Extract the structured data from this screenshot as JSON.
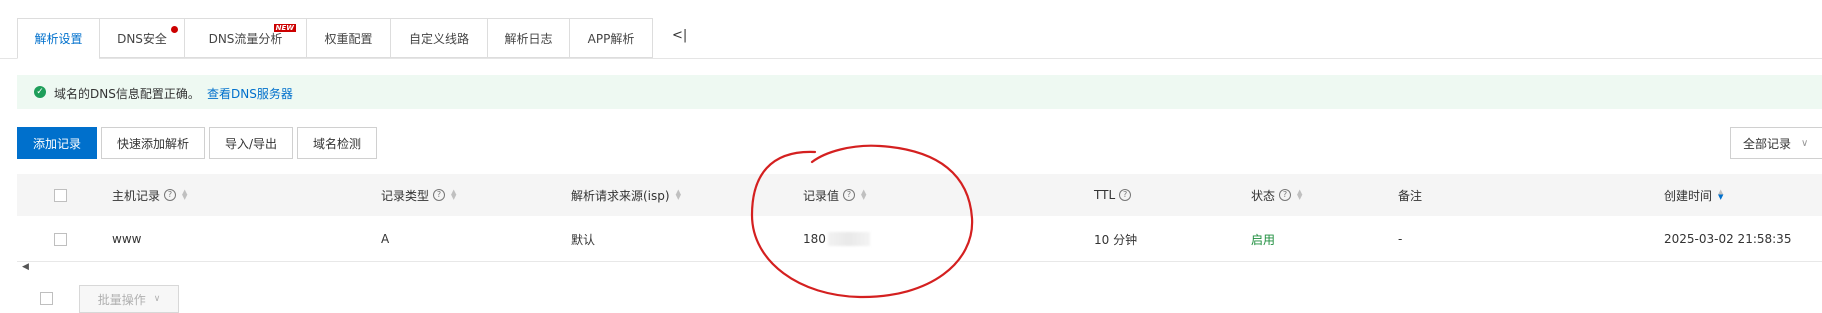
{
  "tabs": [
    {
      "label": "解析设置",
      "active": true
    },
    {
      "label": "DNS安全",
      "dot": true
    },
    {
      "label": "DNS流量分析",
      "badge": "NEW"
    },
    {
      "label": "权重配置"
    },
    {
      "label": "自定义线路"
    },
    {
      "label": "解析日志"
    },
    {
      "label": "APP解析"
    }
  ],
  "collapse_label": "<|",
  "alert": {
    "text": "域名的DNS信息配置正确。",
    "link": "查看DNS服务器"
  },
  "toolbar": {
    "add": "添加记录",
    "quick_add": "快速添加解析",
    "import_export": "导入/导出",
    "domain_check": "域名检测",
    "filter": "全部记录"
  },
  "table": {
    "headers": {
      "host": "主机记录",
      "type": "记录类型",
      "isp": "解析请求来源(isp)",
      "value": "记录值",
      "ttl": "TTL",
      "status": "状态",
      "remark": "备注",
      "created": "创建时间"
    },
    "row": {
      "host": "www",
      "type": "A",
      "isp": "默认",
      "value": "180",
      "ttl": "10 分钟",
      "status": "启用",
      "remark": "-",
      "created": "2025-03-02 21:58:35"
    }
  },
  "batch": "批量操作",
  "colors": {
    "accent": "#0070cc",
    "status_enabled": "#1e8e3e",
    "alert_bg": "#eef9f2",
    "annotation": "#d42020"
  }
}
